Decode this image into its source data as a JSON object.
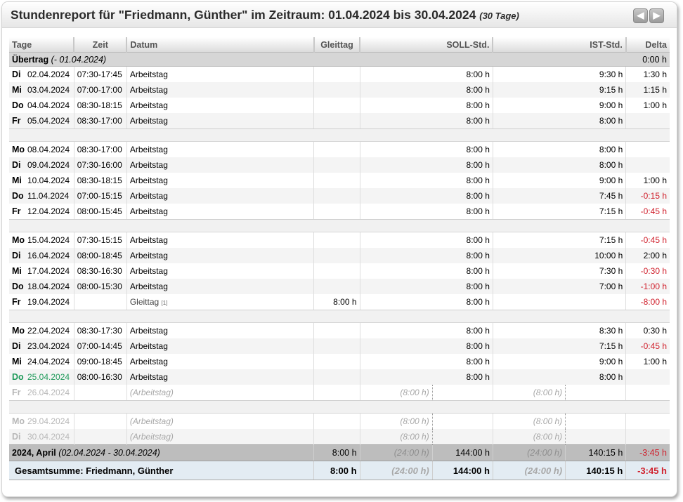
{
  "header": {
    "title": "Stundenreport für \"Friedmann, Günther\" im Zeitraum: 01.04.2024 bis 30.04.2024",
    "days_label": "(30 Tage)",
    "prev_label": "◀",
    "next_label": "▶"
  },
  "columns": {
    "tage": "Tage",
    "zeit": "Zeit",
    "datum": "Datum",
    "gleittag": "Gleittag",
    "soll": "SOLL-Std.",
    "ist": "IST-Std.",
    "delta": "Delta"
  },
  "carry": {
    "label": "Übertrag",
    "range": "(- 01.04.2024)",
    "delta": "0:00 h"
  },
  "rows": [
    {
      "kind": "day",
      "shade": "odd",
      "dow": "Di",
      "date": "02.04.2024",
      "zeit": "07:30-17:45",
      "datum": "Arbeitstag",
      "gleit": "",
      "soll": "8:00 h",
      "ist": "9:30 h",
      "delta": "1:30 h",
      "neg": false,
      "weekend": false
    },
    {
      "kind": "day",
      "shade": "even",
      "dow": "Mi",
      "date": "03.04.2024",
      "zeit": "07:00-17:00",
      "datum": "Arbeitstag",
      "gleit": "",
      "soll": "8:00 h",
      "ist": "9:15 h",
      "delta": "1:15 h",
      "neg": false
    },
    {
      "kind": "day",
      "shade": "odd",
      "dow": "Do",
      "date": "04.04.2024",
      "zeit": "08:30-18:15",
      "datum": "Arbeitstag",
      "gleit": "",
      "soll": "8:00 h",
      "ist": "9:00 h",
      "delta": "1:00 h",
      "neg": false
    },
    {
      "kind": "day",
      "shade": "even",
      "dow": "Fr",
      "date": "05.04.2024",
      "zeit": "08:30-17:00",
      "datum": "Arbeitstag",
      "gleit": "",
      "soll": "8:00 h",
      "ist": "8:00 h",
      "delta": "",
      "neg": false,
      "weekend": true
    },
    {
      "kind": "gap"
    },
    {
      "kind": "day",
      "shade": "odd",
      "dow": "Mo",
      "date": "08.04.2024",
      "zeit": "08:30-17:00",
      "datum": "Arbeitstag",
      "gleit": "",
      "soll": "8:00 h",
      "ist": "8:00 h",
      "delta": "",
      "neg": false
    },
    {
      "kind": "day",
      "shade": "even",
      "dow": "Di",
      "date": "09.04.2024",
      "zeit": "07:30-16:00",
      "datum": "Arbeitstag",
      "gleit": "",
      "soll": "8:00 h",
      "ist": "8:00 h",
      "delta": "",
      "neg": false
    },
    {
      "kind": "day",
      "shade": "odd",
      "dow": "Mi",
      "date": "10.04.2024",
      "zeit": "08:30-18:15",
      "datum": "Arbeitstag",
      "gleit": "",
      "soll": "8:00 h",
      "ist": "9:00 h",
      "delta": "1:00 h",
      "neg": false
    },
    {
      "kind": "day",
      "shade": "even",
      "dow": "Do",
      "date": "11.04.2024",
      "zeit": "07:00-15:15",
      "datum": "Arbeitstag",
      "gleit": "",
      "soll": "8:00 h",
      "ist": "7:45 h",
      "delta": "-0:15 h",
      "neg": true
    },
    {
      "kind": "day",
      "shade": "odd",
      "dow": "Fr",
      "date": "12.04.2024",
      "zeit": "08:00-15:45",
      "datum": "Arbeitstag",
      "gleit": "",
      "soll": "8:00 h",
      "ist": "7:15 h",
      "delta": "-0:45 h",
      "neg": true,
      "weekend": true
    },
    {
      "kind": "gap"
    },
    {
      "kind": "day",
      "shade": "odd",
      "dow": "Mo",
      "date": "15.04.2024",
      "zeit": "07:30-15:15",
      "datum": "Arbeitstag",
      "gleit": "",
      "soll": "8:00 h",
      "ist": "7:15 h",
      "delta": "-0:45 h",
      "neg": true
    },
    {
      "kind": "day",
      "shade": "even",
      "dow": "Di",
      "date": "16.04.2024",
      "zeit": "08:00-18:45",
      "datum": "Arbeitstag",
      "gleit": "",
      "soll": "8:00 h",
      "ist": "10:00 h",
      "delta": "2:00 h",
      "neg": false
    },
    {
      "kind": "day",
      "shade": "odd",
      "dow": "Mi",
      "date": "17.04.2024",
      "zeit": "08:30-16:30",
      "datum": "Arbeitstag",
      "gleit": "",
      "soll": "8:00 h",
      "ist": "7:30 h",
      "delta": "-0:30 h",
      "neg": true
    },
    {
      "kind": "day",
      "shade": "even",
      "dow": "Do",
      "date": "18.04.2024",
      "zeit": "08:00-15:30",
      "datum": "Arbeitstag",
      "gleit": "",
      "soll": "8:00 h",
      "ist": "7:00 h",
      "delta": "-1:00 h",
      "neg": true
    },
    {
      "kind": "day",
      "shade": "odd",
      "dow": "Fr",
      "date": "19.04.2024",
      "zeit": "",
      "datum": "Gleittag",
      "footnote": "[1]",
      "gleit": "8:00 h",
      "soll": "8:00 h",
      "ist": "",
      "delta": "-8:00 h",
      "neg": true,
      "weekend": true,
      "gleittagStyle": true
    },
    {
      "kind": "gap"
    },
    {
      "kind": "day",
      "shade": "odd",
      "dow": "Mo",
      "date": "22.04.2024",
      "zeit": "08:30-17:30",
      "datum": "Arbeitstag",
      "gleit": "",
      "soll": "8:00 h",
      "ist": "8:30 h",
      "delta": "0:30 h",
      "neg": false
    },
    {
      "kind": "day",
      "shade": "even",
      "dow": "Di",
      "date": "23.04.2024",
      "zeit": "07:00-14:45",
      "datum": "Arbeitstag",
      "gleit": "",
      "soll": "8:00 h",
      "ist": "7:15 h",
      "delta": "-0:45 h",
      "neg": true
    },
    {
      "kind": "day",
      "shade": "odd",
      "dow": "Mi",
      "date": "24.04.2024",
      "zeit": "09:00-18:45",
      "datum": "Arbeitstag",
      "gleit": "",
      "soll": "8:00 h",
      "ist": "9:00 h",
      "delta": "1:00 h",
      "neg": false
    },
    {
      "kind": "day",
      "shade": "even",
      "dow": "Do",
      "date": "25.04.2024",
      "zeit": "08:00-16:30",
      "datum": "Arbeitstag",
      "gleit": "",
      "soll": "8:00 h",
      "ist": "8:00 h",
      "delta": "",
      "neg": false,
      "today": true
    },
    {
      "kind": "day",
      "shade": "odd",
      "dow": "Fr",
      "date": "26.04.2024",
      "zeit": "",
      "datum": "(Arbeitstag)",
      "gleit": "",
      "sollFuture": "(8:00 h)",
      "istFuture": "(8:00 h)",
      "delta": "",
      "future": true,
      "weekend": true
    },
    {
      "kind": "gap"
    },
    {
      "kind": "day",
      "shade": "odd",
      "dow": "Mo",
      "date": "29.04.2024",
      "zeit": "",
      "datum": "(Arbeitstag)",
      "gleit": "",
      "sollFuture": "(8:00 h)",
      "istFuture": "(8:00 h)",
      "delta": "",
      "future": true
    },
    {
      "kind": "day",
      "shade": "even",
      "dow": "Di",
      "date": "30.04.2024",
      "zeit": "",
      "datum": "(Arbeitstag)",
      "gleit": "",
      "sollFuture": "(8:00 h)",
      "istFuture": "(8:00 h)",
      "delta": "",
      "future": true
    }
  ],
  "month": {
    "label": "2024, April",
    "range": "(02.04.2024 - 30.04.2024)",
    "gleit": "8:00 h",
    "soll_plan": "(24:00 h)",
    "soll": "144:00 h",
    "ist_plan": "(24:00 h)",
    "ist": "140:15 h",
    "delta": "-3:45 h"
  },
  "total": {
    "label": "Gesamtsumme: Friedmann, Günther",
    "gleit": "8:00 h",
    "soll_plan": "(24:00 h)",
    "soll": "144:00 h",
    "ist_plan": "(24:00 h)",
    "ist": "140:15 h",
    "delta": "-3:45 h"
  },
  "colors": {
    "negative": "#d0202c",
    "today": "#1f9a5a",
    "future": "#b8b8b8",
    "total_bg": "#e3ecf3",
    "month_bg": "#bdbdbd"
  }
}
